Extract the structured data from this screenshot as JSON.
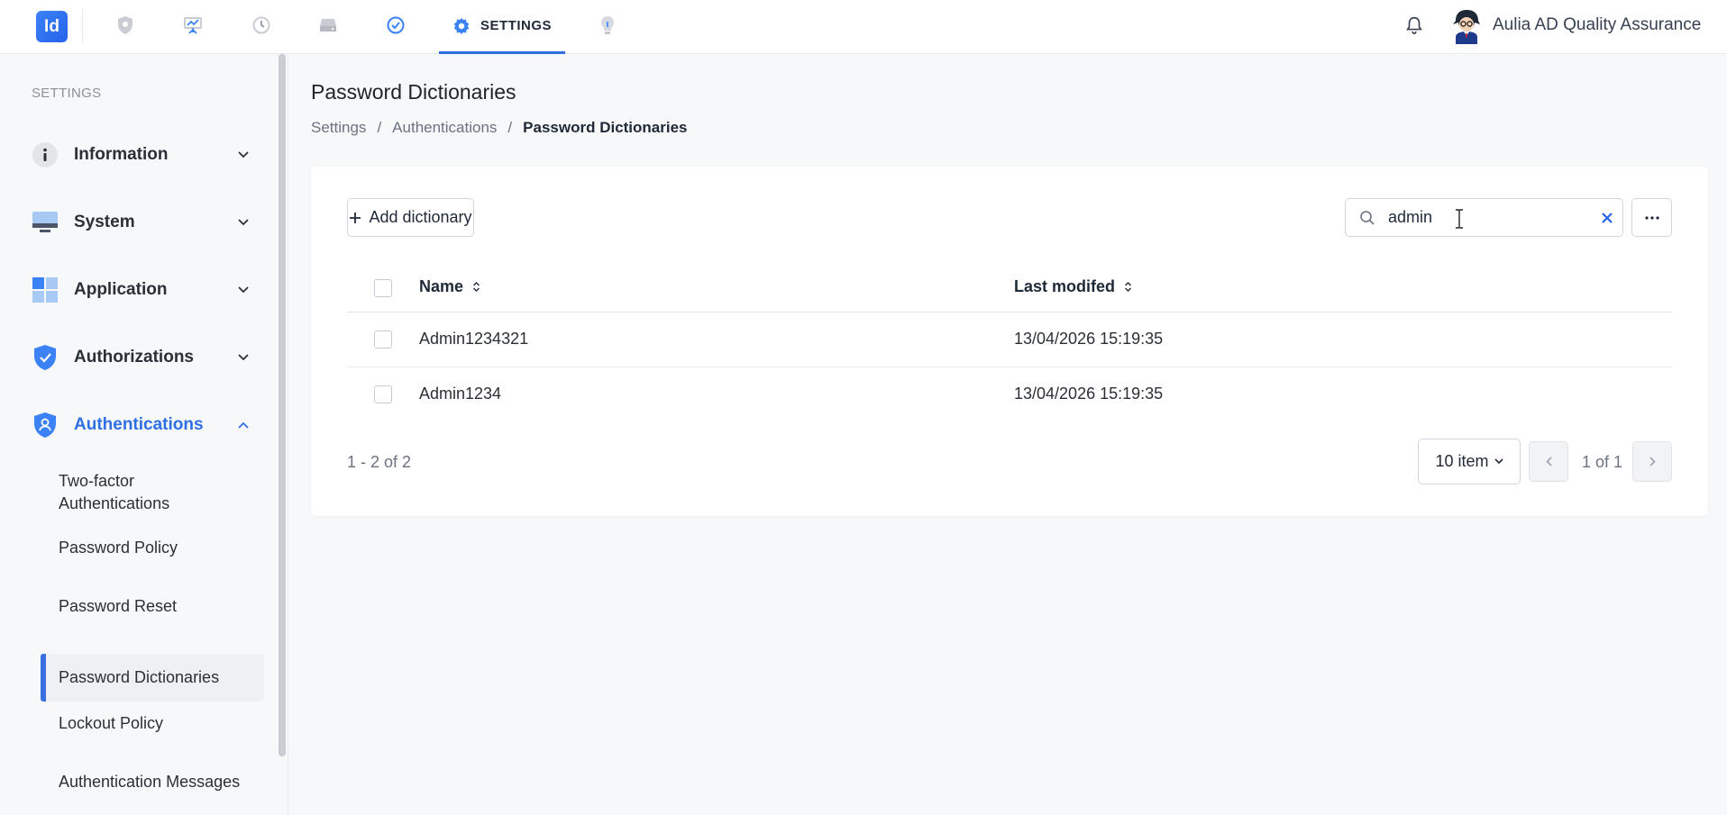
{
  "app": {
    "logo_text": "Id"
  },
  "topnav": {
    "icons": [
      "shield-icon",
      "presentation-icon",
      "history-icon",
      "drive-icon",
      "check-circle-icon"
    ],
    "active_tab": "SETTINGS",
    "extra_icon": "bulb-icon"
  },
  "user": {
    "name": "Aulia AD Quality Assurance"
  },
  "sidebar": {
    "heading": "SETTINGS",
    "items": [
      {
        "label": "Information",
        "icon": "info-icon",
        "expanded": false
      },
      {
        "label": "System",
        "icon": "monitor-icon",
        "expanded": false
      },
      {
        "label": "Application",
        "icon": "grid-icon",
        "expanded": false
      },
      {
        "label": "Authorizations",
        "icon": "shield-check-icon",
        "expanded": false
      },
      {
        "label": "Authentications",
        "icon": "shield-user-icon",
        "expanded": true
      }
    ],
    "subitems": [
      {
        "label": "Two-factor Authentications"
      },
      {
        "label": "Password Policy"
      },
      {
        "label": "Password Reset"
      },
      {
        "label": "Password Dictionaries"
      },
      {
        "label": "Lockout Policy"
      },
      {
        "label": "Authentication Messages"
      }
    ],
    "selected_subitem": "Password Dictionaries"
  },
  "page": {
    "title": "Password Dictionaries",
    "breadcrumb": [
      "Settings",
      "Authentications",
      "Password Dictionaries"
    ],
    "separator": "/"
  },
  "toolbar": {
    "add_label": "Add dictionary",
    "search_value": "admin"
  },
  "table": {
    "columns": [
      "Name",
      "Last modifed"
    ],
    "rows": [
      {
        "name": "Admin1234321",
        "modified": "13/04/2026 15:19:35"
      },
      {
        "name": "Admin1234",
        "modified": "13/04/2026 15:19:35"
      }
    ]
  },
  "pagination": {
    "count": "1 - 2 of 2",
    "page_size": "10 item",
    "page_label": "1 of 1"
  },
  "colors": {
    "accent": "#2f6fe4",
    "background": "#f7f8fa"
  }
}
